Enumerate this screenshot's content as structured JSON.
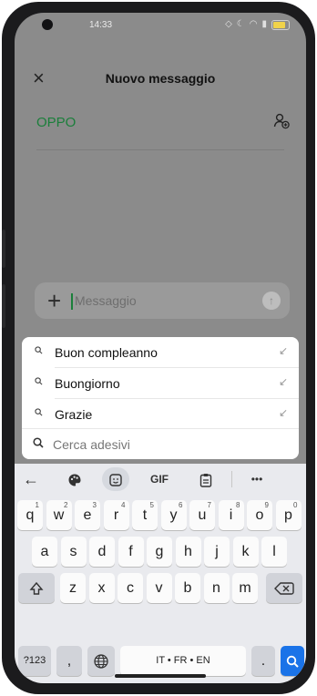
{
  "status": {
    "time": "14:33"
  },
  "header": {
    "title": "Nuovo messaggio",
    "close_icon": "close-icon"
  },
  "recipient": {
    "name": "OPPO"
  },
  "composer": {
    "placeholder": "Messaggio"
  },
  "suggestions": [
    {
      "label": "Buon compleanno"
    },
    {
      "label": "Buongiorno"
    },
    {
      "label": "Grazie"
    }
  ],
  "sticker_search": {
    "placeholder": "Cerca adesivi"
  },
  "keyboard": {
    "toolbar": [
      "back-icon",
      "palette-icon",
      "sticker-icon",
      "GIF",
      "clipboard-icon",
      "more-icon"
    ],
    "gif_label": "GIF",
    "more_label": "•••",
    "row1": [
      {
        "k": "q",
        "n": "1"
      },
      {
        "k": "w",
        "n": "2"
      },
      {
        "k": "e",
        "n": "3"
      },
      {
        "k": "r",
        "n": "4"
      },
      {
        "k": "t",
        "n": "5"
      },
      {
        "k": "y",
        "n": "6"
      },
      {
        "k": "u",
        "n": "7"
      },
      {
        "k": "i",
        "n": "8"
      },
      {
        "k": "o",
        "n": "9"
      },
      {
        "k": "p",
        "n": "0"
      }
    ],
    "row2": [
      "a",
      "s",
      "d",
      "f",
      "g",
      "h",
      "j",
      "k",
      "l"
    ],
    "row3": [
      "z",
      "x",
      "c",
      "v",
      "b",
      "n",
      "m"
    ],
    "symbols_label": "?123",
    "comma_label": ",",
    "space_label": "IT • FR • EN",
    "period_label": ".",
    "accent": "#1a73e8"
  }
}
